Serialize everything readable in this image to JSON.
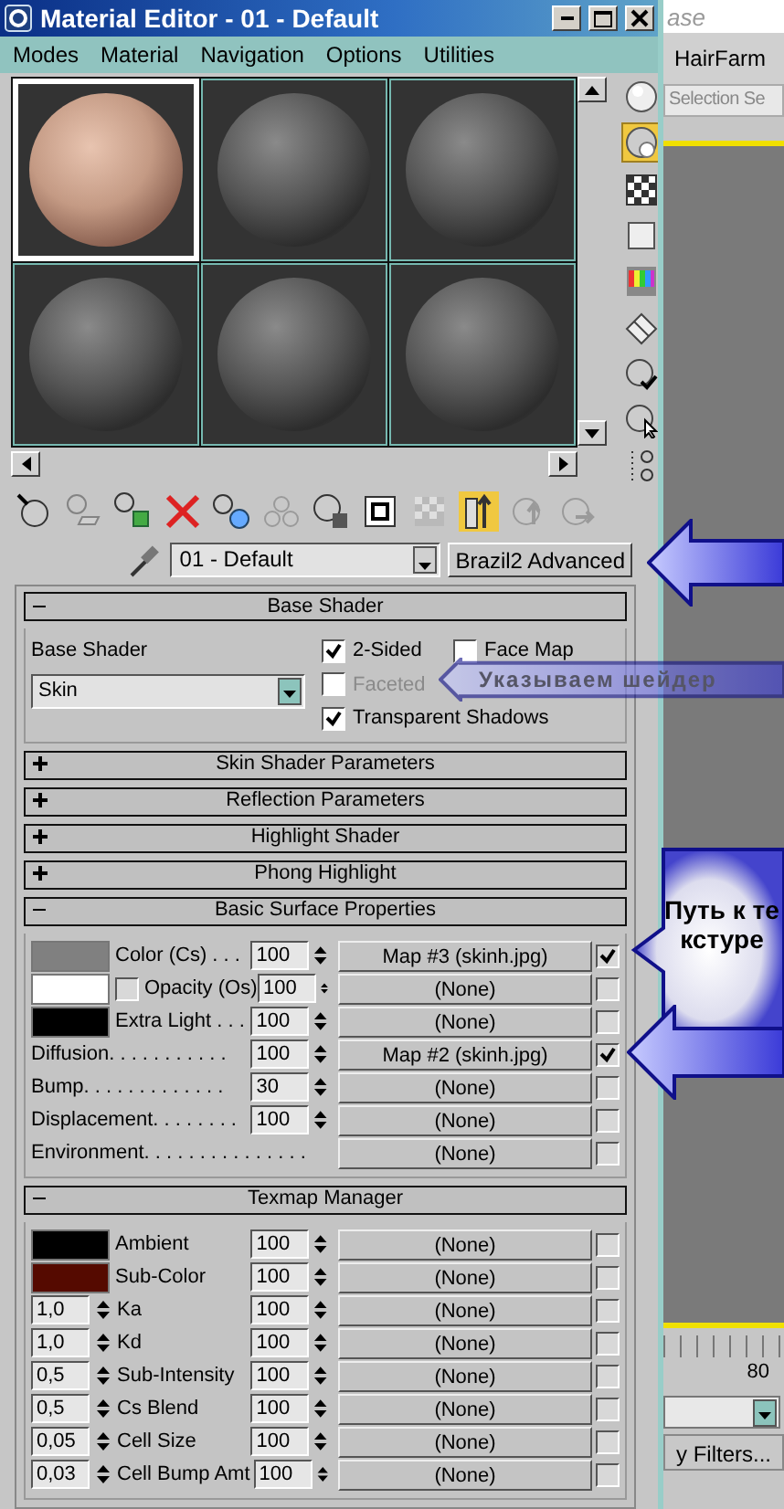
{
  "window": {
    "title": "Material Editor - 01 - Default"
  },
  "menu": [
    "Modes",
    "Material",
    "Navigation",
    "Options",
    "Utilities"
  ],
  "sample_slots": [
    {
      "kind": "skin",
      "selected": true
    },
    {
      "kind": "plain",
      "selected": false
    },
    {
      "kind": "plain",
      "selected": false
    },
    {
      "kind": "plain",
      "selected": false
    },
    {
      "kind": "plain",
      "selected": false
    },
    {
      "kind": "plain",
      "selected": false
    }
  ],
  "side_tools": [
    {
      "kind": "sphere",
      "on": false
    },
    {
      "kind": "backlight",
      "on": true
    },
    {
      "kind": "checker",
      "on": false
    },
    {
      "kind": "square",
      "on": false
    },
    {
      "kind": "colorbars",
      "on": false
    },
    {
      "kind": "diamond",
      "on": false
    },
    {
      "kind": "spherecheck",
      "on": false
    },
    {
      "kind": "spherecursor",
      "on": false
    },
    {
      "kind": "tree",
      "on": false
    }
  ],
  "toolbar": [
    {
      "kind": "get",
      "on": false,
      "disabled": false
    },
    {
      "kind": "put",
      "on": false,
      "disabled": true
    },
    {
      "kind": "assign",
      "on": false,
      "disabled": false
    },
    {
      "kind": "reset",
      "on": false,
      "disabled": false
    },
    {
      "kind": "copy",
      "on": false,
      "disabled": false
    },
    {
      "kind": "unique",
      "on": false,
      "disabled": true
    },
    {
      "kind": "library",
      "on": false,
      "disabled": false
    },
    {
      "kind": "id",
      "on": false,
      "disabled": false
    },
    {
      "kind": "showmap",
      "on": false,
      "disabled": true
    },
    {
      "kind": "endresult",
      "on": true,
      "disabled": false
    },
    {
      "kind": "parent",
      "on": false,
      "disabled": true
    },
    {
      "kind": "forward",
      "on": false,
      "disabled": true
    }
  ],
  "material_name": "01 - Default",
  "material_type": "Brazil2 Advanced",
  "base_shader": {
    "title": "Base Shader",
    "expanded": true,
    "label": "Base Shader",
    "value": "Skin",
    "options": [
      {
        "label": "2-Sided",
        "checked": true,
        "disabled": false
      },
      {
        "label": "Face Map",
        "checked": false,
        "disabled": false
      },
      {
        "label": "Faceted",
        "checked": false,
        "disabled": true
      },
      {
        "label": "Transparent Shadows",
        "checked": true,
        "disabled": false
      }
    ]
  },
  "rollouts": [
    {
      "title": "Skin Shader Parameters",
      "expanded": false
    },
    {
      "title": "Reflection Parameters",
      "expanded": false
    },
    {
      "title": "Highlight Shader",
      "expanded": false
    },
    {
      "title": "Phong Highlight",
      "expanded": false
    }
  ],
  "basic_surface": {
    "title": "Basic Surface Properties",
    "expanded": true,
    "rows": [
      {
        "kind": "swatch",
        "color": "#808080",
        "label": "Color (Cs) . . .",
        "amount": "100",
        "map": "Map #3 (skinh.jpg)",
        "enabled": true
      },
      {
        "kind": "swatch_check",
        "color": "#ffffff",
        "checked": false,
        "label": "Opacity (Os)",
        "amount": "100",
        "map": "(None)",
        "enabled": false
      },
      {
        "kind": "swatch",
        "color": "#000000",
        "label": "Extra Light . . .",
        "amount": "100",
        "map": "(None)",
        "enabled": false
      },
      {
        "kind": "plain",
        "label": "Diffusion. . . . . . . . . . .",
        "amount": "100",
        "map": "Map #2 (skinh.jpg)",
        "enabled": true
      },
      {
        "kind": "plain",
        "label": "Bump. . . . . . . . . . . . .",
        "amount": "30",
        "map": "(None)",
        "enabled": false
      },
      {
        "kind": "plain",
        "label": "Displacement. . . . . . . .",
        "amount": "100",
        "map": "(None)",
        "enabled": false
      },
      {
        "kind": "noamount",
        "label": "Environment. . . . . . . . . . . . . . .",
        "map": "(None)",
        "enabled": false
      }
    ]
  },
  "texmap_manager": {
    "title": "Texmap Manager",
    "expanded": true,
    "rows": [
      {
        "kind": "swatch",
        "color": "#000000",
        "label": "Ambient",
        "amount": "100",
        "map": "(None)",
        "enabled": false
      },
      {
        "kind": "swatch",
        "color": "#550a00",
        "label": "Sub-Color",
        "amount": "100",
        "map": "(None)",
        "enabled": false
      },
      {
        "kind": "spinner",
        "value": "1,0",
        "label": "Ka",
        "amount": "100",
        "map": "(None)",
        "enabled": false
      },
      {
        "kind": "spinner",
        "value": "1,0",
        "label": "Kd",
        "amount": "100",
        "map": "(None)",
        "enabled": false
      },
      {
        "kind": "spinner",
        "value": "0,5",
        "label": "Sub-Intensity",
        "amount": "100",
        "map": "(None)",
        "enabled": false
      },
      {
        "kind": "spinner",
        "value": "0,5",
        "label": "Cs Blend",
        "amount": "100",
        "map": "(None)",
        "enabled": false
      },
      {
        "kind": "spinner",
        "value": "0,05",
        "label": "Cell Size",
        "amount": "100",
        "map": "(None)",
        "enabled": false
      },
      {
        "kind": "spinner",
        "value": "0,03",
        "label": "Cell Bump Amt",
        "amount": "100",
        "map": "(None)",
        "enabled": false
      }
    ]
  },
  "background": {
    "top_field": "ase",
    "tab": "HairFarm",
    "selection_field": "Selection Se",
    "ruler_label": "80",
    "filters_button": "y Filters..."
  },
  "annotations": [
    {
      "text": "Указываем шейдер"
    },
    {
      "text": "Путь к текстуре"
    }
  ]
}
